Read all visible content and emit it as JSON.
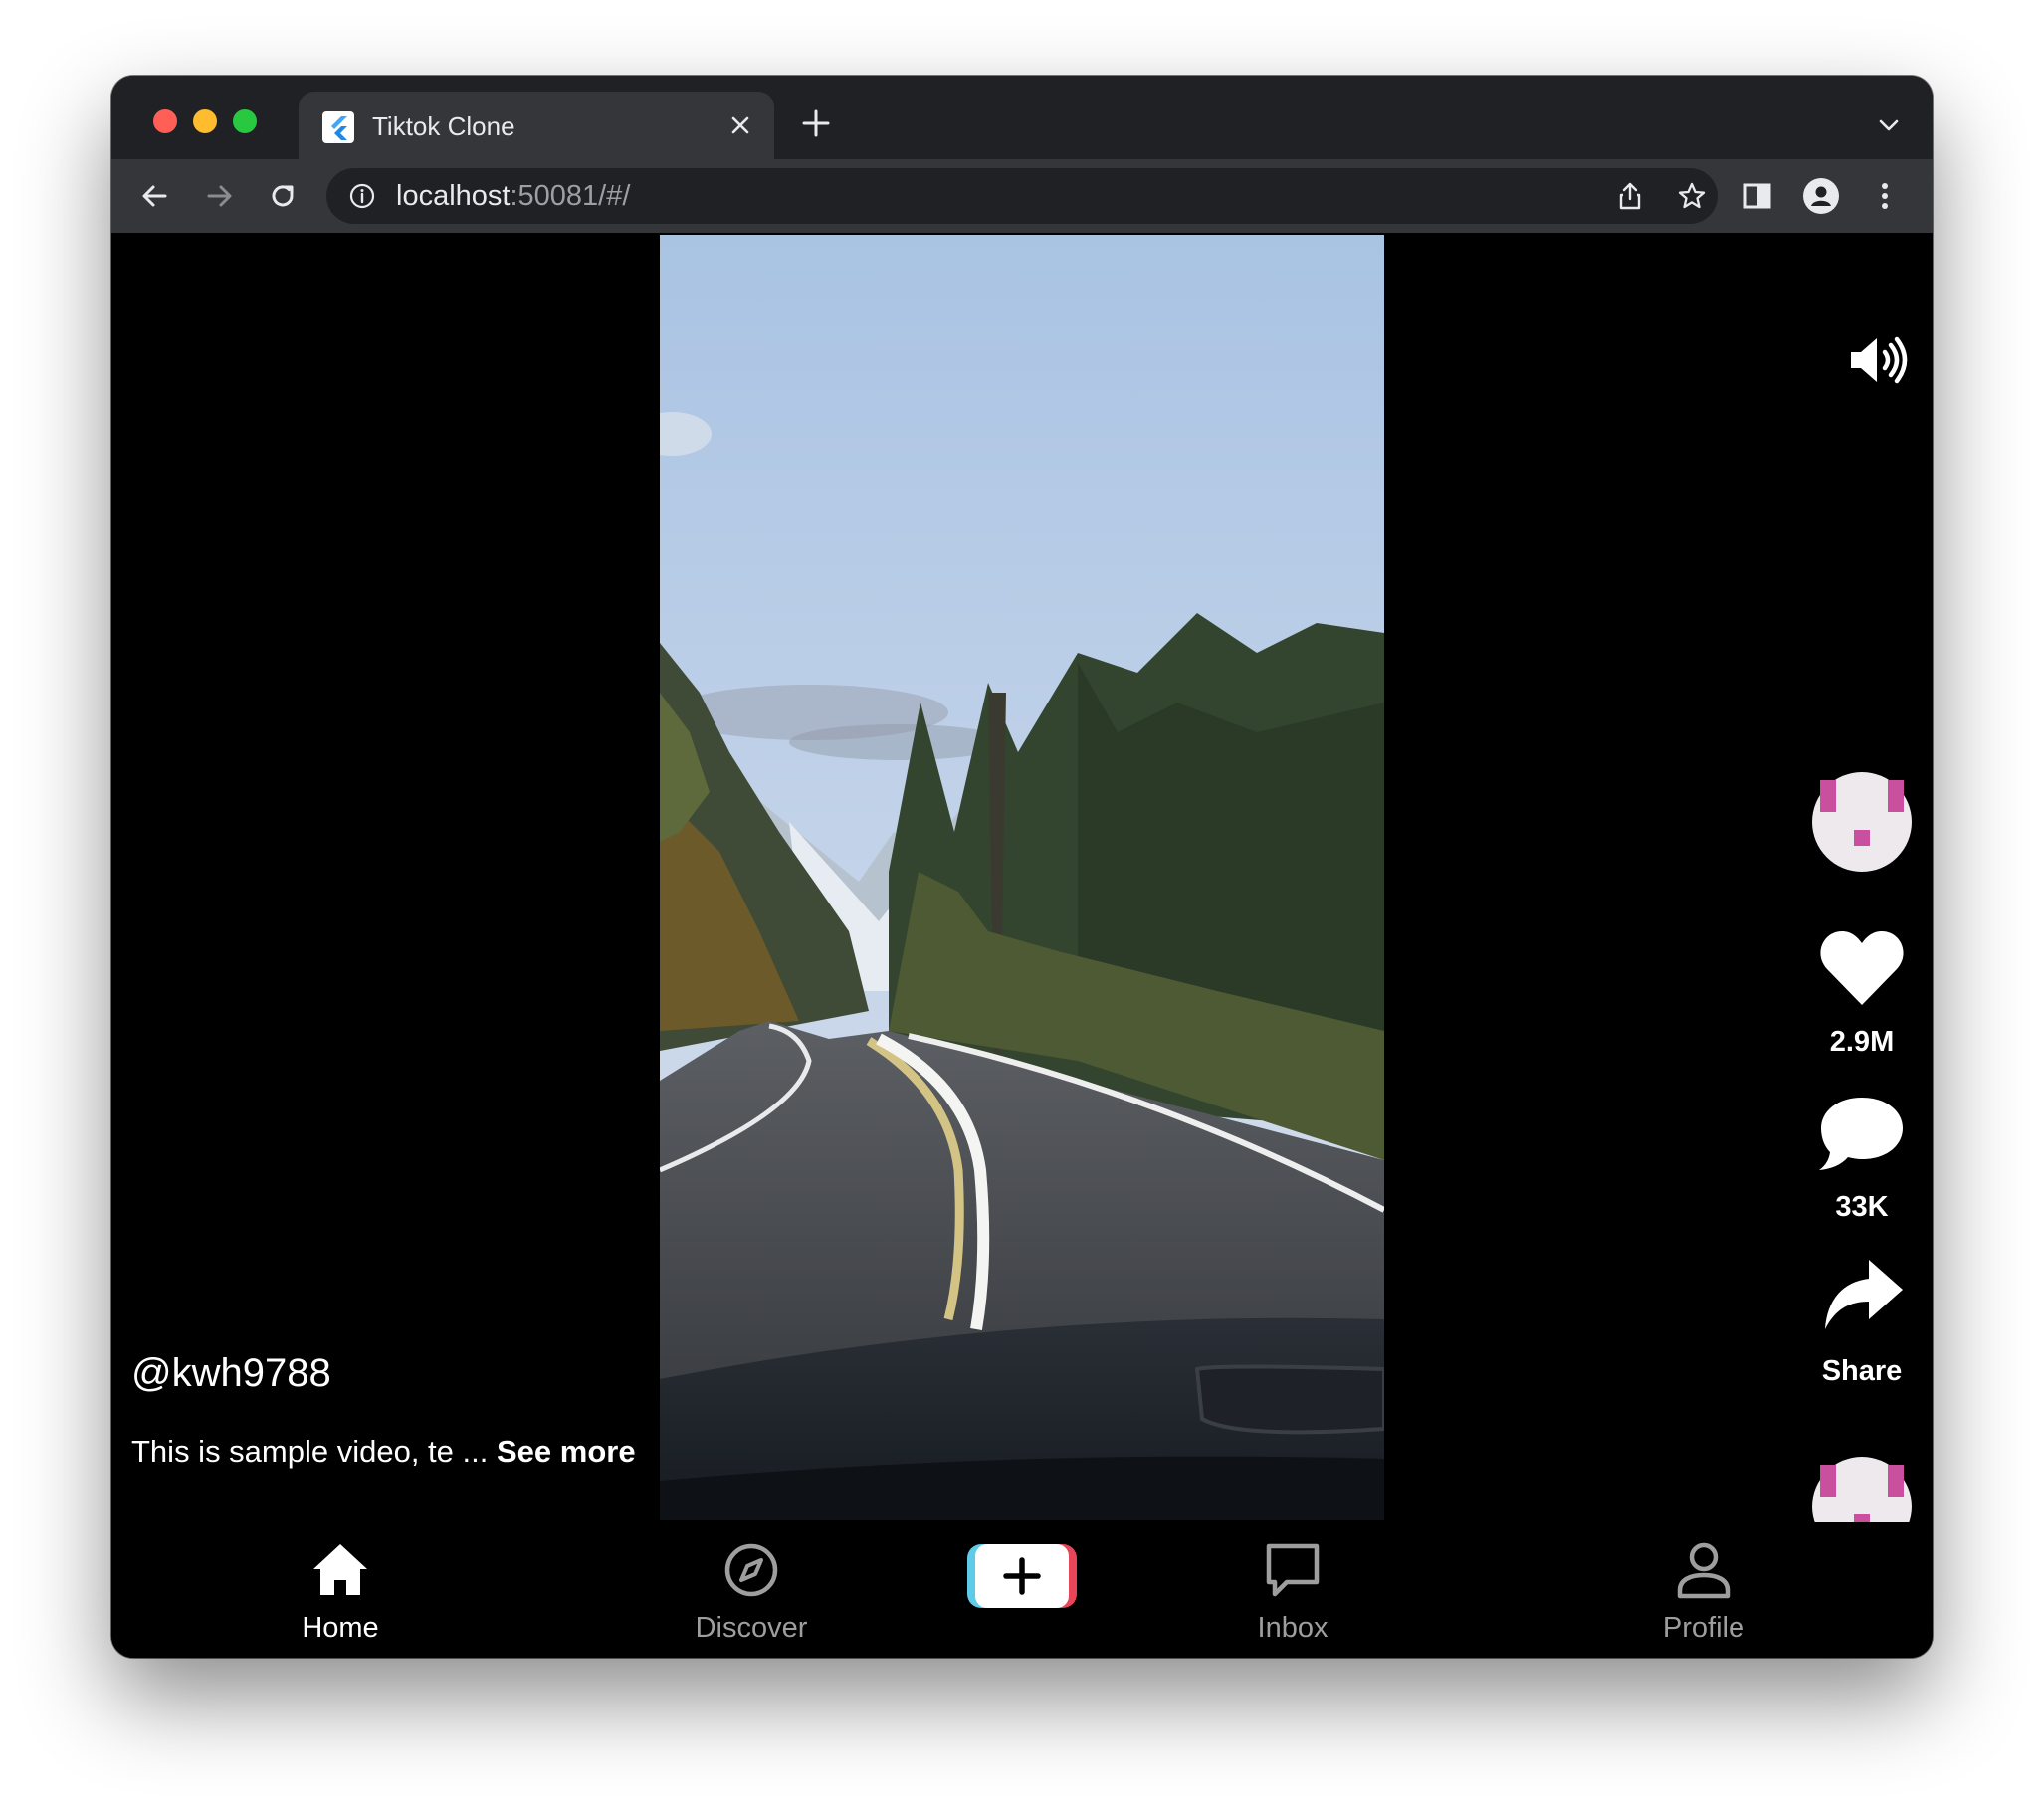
{
  "browser": {
    "tab_title": "Tiktok Clone",
    "url_host": "localhost",
    "url_rest": ":50081/#/"
  },
  "post": {
    "username": "@kwh9788",
    "caption": "This is sample video, te ... ",
    "see_more": "See more"
  },
  "actions": {
    "likes": "2.9M",
    "comments": "33K",
    "share": "Share"
  },
  "nav": {
    "home": "Home",
    "discover": "Discover",
    "inbox": "Inbox",
    "profile": "Profile"
  },
  "colors": {
    "avatar_accent": "#c9509e",
    "create_left": "#5ecbe8",
    "create_right": "#e8455a"
  }
}
